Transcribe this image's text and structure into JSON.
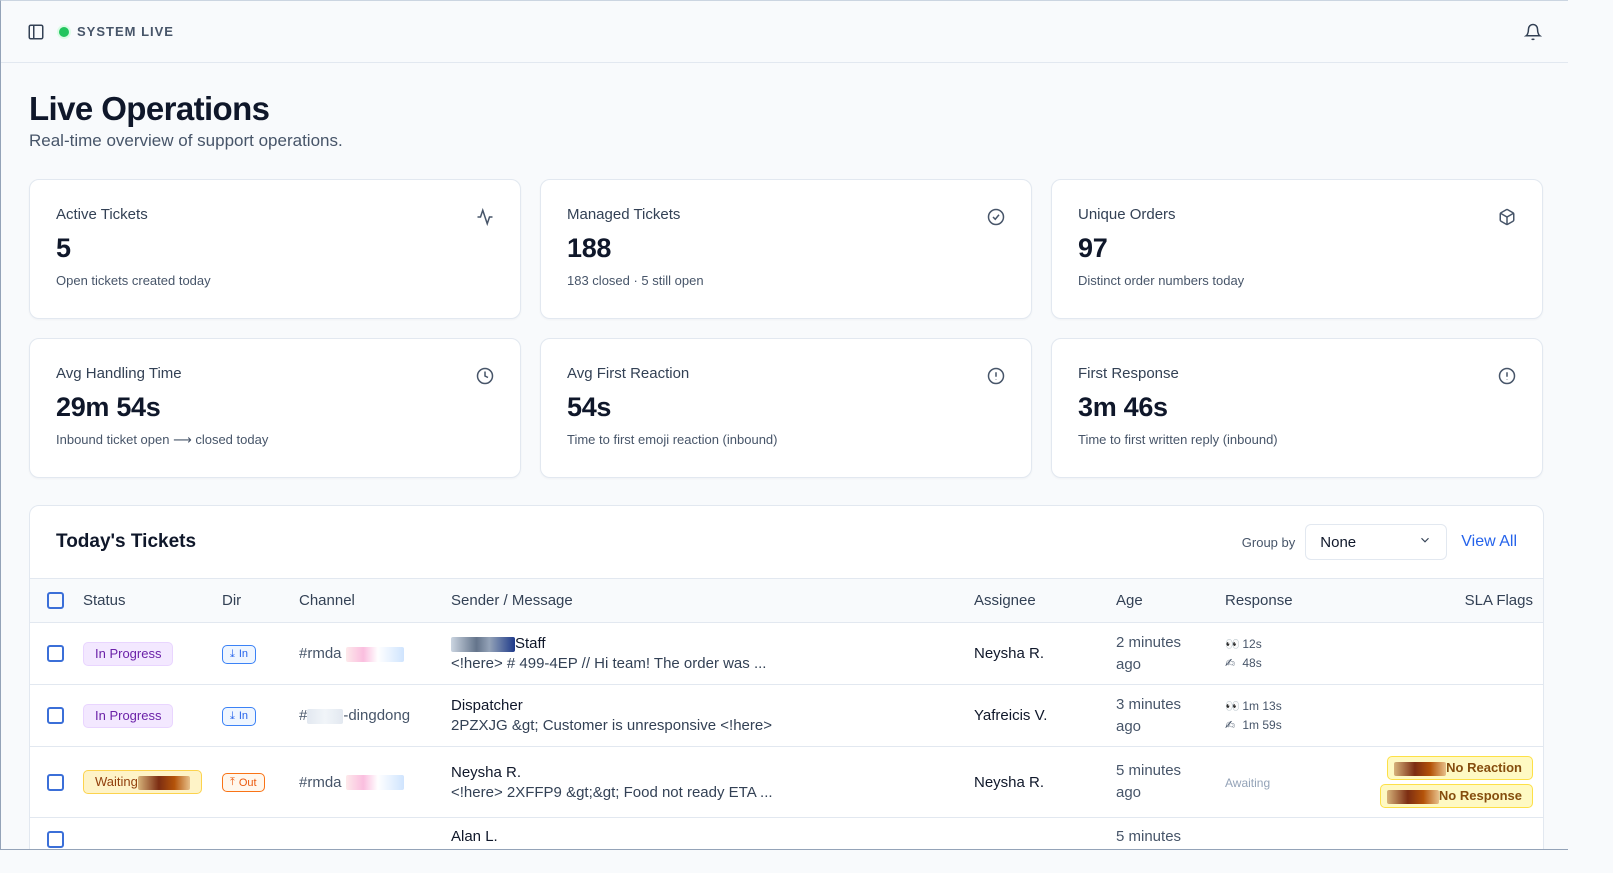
{
  "topbar": {
    "status_label": "SYSTEM LIVE",
    "status_color": "#22c55e"
  },
  "page": {
    "title": "Live Operations",
    "subtitle": "Real-time overview of support operations."
  },
  "stats": [
    {
      "title": "Active Tickets",
      "value": "5",
      "note": "Open tickets created today",
      "icon": "activity-icon"
    },
    {
      "title": "Managed Tickets",
      "value": "188",
      "note": "183 closed · 5 still open",
      "icon": "check-circle-icon"
    },
    {
      "title": "Unique Orders",
      "value": "97",
      "note": "Distinct order numbers today",
      "icon": "package-icon"
    },
    {
      "title": "Avg Handling Time",
      "value": "29m 54s",
      "note": "Inbound ticket open ⟶ closed today",
      "icon": "clock-icon"
    },
    {
      "title": "Avg First Reaction",
      "value": "54s",
      "note": "Time to first emoji reaction (inbound)",
      "icon": "alert-circle-icon"
    },
    {
      "title": "First Response",
      "value": "3m 46s",
      "note": "Time to first written reply (inbound)",
      "icon": "alert-circle-icon"
    }
  ],
  "tickets": {
    "title": "Today's Tickets",
    "group_by_label": "Group by",
    "group_by_value": "None",
    "view_all_label": "View All",
    "columns": [
      "Status",
      "Dir",
      "Channel",
      "Sender / Message",
      "Assignee",
      "Age",
      "Response",
      "SLA Flags"
    ],
    "rows": [
      {
        "status": "In Progress",
        "dir": "In",
        "channel": "#rmda",
        "sender": "Staff",
        "message": "<!here> # 499-4EP // Hi team! The order was ...",
        "assignee": "Neysha R.",
        "age_line1": "2 minutes",
        "age_line2": "ago",
        "response_reaction": "12s",
        "response_reply": "48s"
      },
      {
        "status": "In Progress",
        "dir": "In",
        "channel_prefix": "#",
        "channel": "-dingdong",
        "sender": "Dispatcher",
        "message": "2PZXJG &gt; Customer is unresponsive <!here>",
        "assignee": "Yafreicis V.",
        "age_line1": "3 minutes",
        "age_line2": "ago",
        "response_reaction": "1m 13s",
        "response_reply": "1m 59s"
      },
      {
        "status": "Waiting",
        "dir": "Out",
        "channel": "#rmda",
        "sender": "Neysha R.",
        "message": "<!here> 2XFFP9 &gt;&gt; Food not ready ETA ...",
        "assignee": "Neysha R.",
        "age_line1": "5 minutes",
        "age_line2": "ago",
        "response_awaiting": "Awaiting",
        "sla_flags": [
          "No Reaction",
          "No Response"
        ]
      },
      {
        "sender": "Alan L.",
        "age_line1": "5 minutes"
      }
    ]
  }
}
